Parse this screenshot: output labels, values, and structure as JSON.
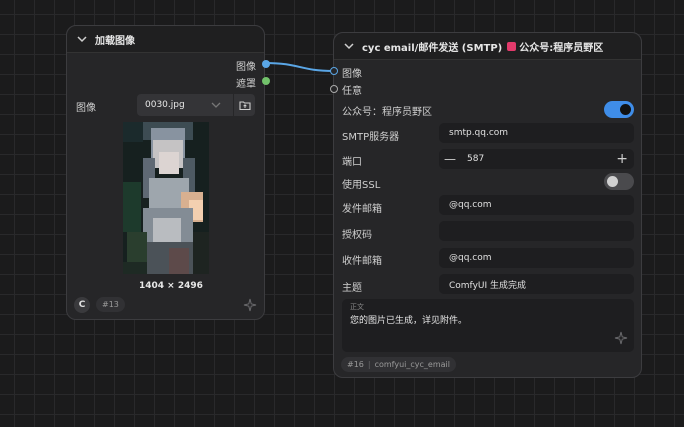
{
  "load_node": {
    "title": "加载图像",
    "outputs": [
      "图像",
      "遮罩"
    ],
    "image_label": "图像",
    "file_name": "0030.jpg",
    "dimensions": "1404 × 2496",
    "badge": "#13"
  },
  "email_node": {
    "title": "cyc email/邮件发送 (SMTP)",
    "title_tag": "公众号:程序员野区",
    "inputs": [
      "图像",
      "任意"
    ],
    "fields": {
      "public_account_label": "公众号：程序员野区",
      "smtp_label": "SMTP服务器",
      "smtp_value": "smtp.qq.com",
      "port_label": "端口",
      "port_value": "587",
      "ssl_label": "使用SSL",
      "sender_label": "发件邮箱",
      "sender_value": "@qq.com",
      "auth_label": "授权码",
      "auth_value": "",
      "recipient_label": "收件邮箱",
      "recipient_value": "@qq.com",
      "subject_label": "主题",
      "subject_value": "ComfyUI 生成完成",
      "body_label": "正文",
      "body_value": "您的图片已生成，详见附件。"
    },
    "badge_id": "#16",
    "badge_name": "comfyui_cyc_email"
  },
  "colors": {
    "image_port": "#5aa6e6",
    "mask_port": "#72c26b",
    "toggle_on": "#3f8de8",
    "title_tag": "#e23a6b"
  }
}
